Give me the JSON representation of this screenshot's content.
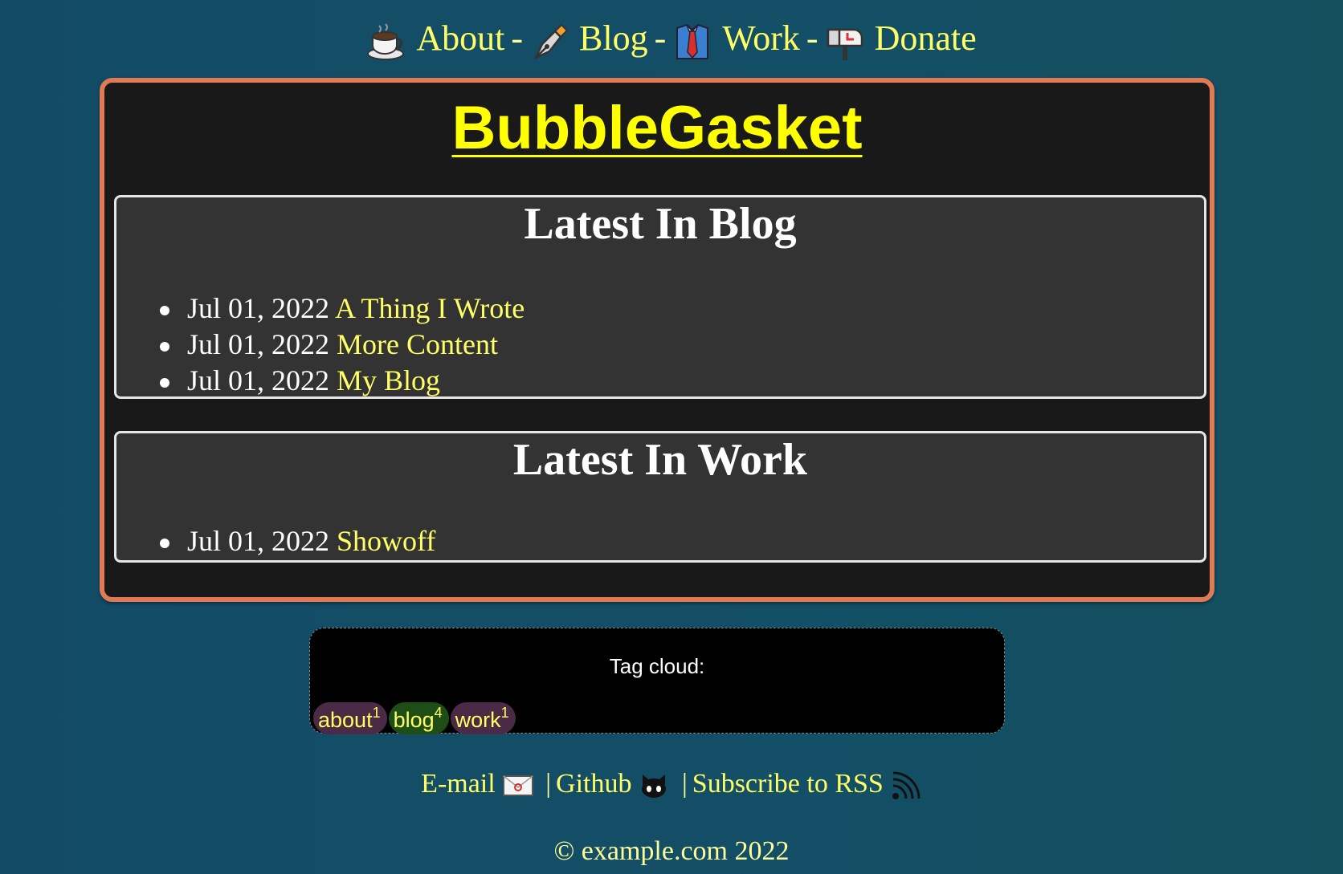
{
  "nav": {
    "items": [
      {
        "label": "About",
        "icon": "coffee-cup-icon"
      },
      {
        "label": "Blog",
        "icon": "fountain-pen-icon"
      },
      {
        "label": "Work",
        "icon": "shirt-tie-icon"
      },
      {
        "label": "Donate",
        "icon": "mailbox-icon"
      }
    ],
    "separator": "-"
  },
  "site": {
    "title": "BubbleGasket"
  },
  "blog": {
    "heading": "Latest In Blog",
    "posts": [
      {
        "date": "Jul 01, 2022",
        "title": "A Thing I Wrote"
      },
      {
        "date": "Jul 01, 2022",
        "title": "More Content"
      },
      {
        "date": "Jul 01, 2022",
        "title": "My Blog"
      }
    ]
  },
  "work": {
    "heading": "Latest In Work",
    "posts": [
      {
        "date": "Jul 01, 2022",
        "title": "Showoff"
      }
    ]
  },
  "tagcloud": {
    "label": "Tag cloud:",
    "tags": [
      {
        "name": "about",
        "count": "1",
        "color": "#4a2a44"
      },
      {
        "name": "blog",
        "count": "4",
        "color": "#1e4d16"
      },
      {
        "name": "work",
        "count": "1",
        "color": "#4a2a44"
      }
    ]
  },
  "footer": {
    "email_label": "E-mail",
    "github_label": "Github",
    "rss_label": "Subscribe to RSS",
    "separator": "|",
    "copyright": "© example.com 2022"
  },
  "colors": {
    "background": "#134b66",
    "card_border": "#e07a55",
    "link": "#ffff66",
    "title": "#ffff00"
  }
}
